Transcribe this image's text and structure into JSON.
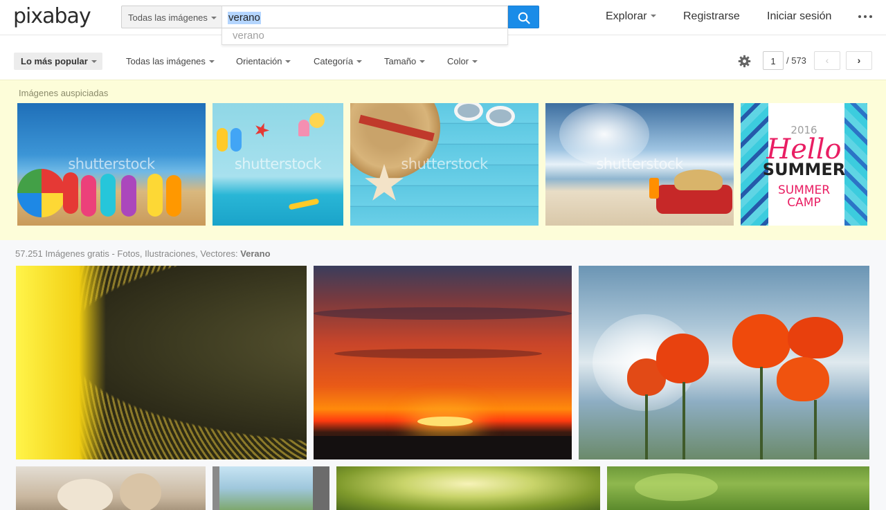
{
  "header": {
    "logo": "pixabay",
    "search_type": "Todas las imágenes",
    "search_value": "verano",
    "suggestion": "verano",
    "nav": {
      "explore": "Explorar",
      "register": "Registrarse",
      "login": "Iniciar sesión"
    }
  },
  "filters": {
    "popular": "Lo más popular",
    "all_images": "Todas las imágenes",
    "orientation": "Orientación",
    "category": "Categoría",
    "size": "Tamaño",
    "color": "Color",
    "page_current": "1",
    "page_total": "/ 573",
    "prev": "‹",
    "next": "›"
  },
  "sponsored": {
    "label": "Imágenes auspiciadas",
    "watermark": "shutterstock",
    "img5_year": "2016",
    "img5_hello": "Hello",
    "img5_summer": "SUMMER",
    "img5_camp1": "SUMMER",
    "img5_camp2": "CAMP"
  },
  "results": {
    "count_text": "57.251 Imágenes gratis - Fotos, Ilustraciones, Vectores:",
    "query": "Verano"
  },
  "colors": {
    "accent": "#1a8ce8",
    "sponsored_bg": "#fdfdd9"
  }
}
